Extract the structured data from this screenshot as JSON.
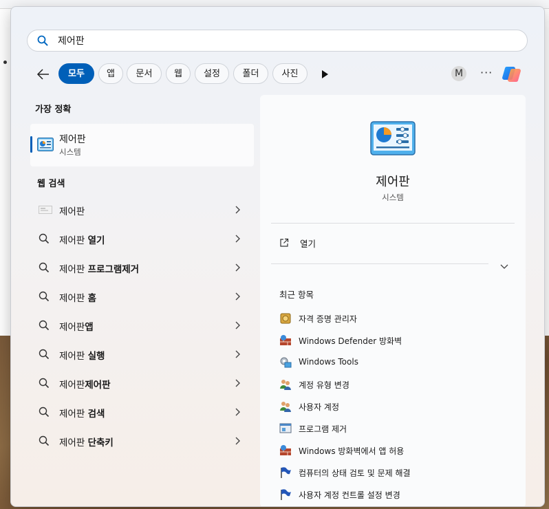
{
  "search": {
    "value": "제어판"
  },
  "filters": {
    "back_label": "뒤로",
    "chips": [
      "모두",
      "앱",
      "문서",
      "웹",
      "설정",
      "폴더",
      "사진"
    ],
    "avatar": "M",
    "more": "···"
  },
  "best_match": {
    "section_title": "가장 정확",
    "title": "제어판",
    "subtitle": "시스템"
  },
  "web_search": {
    "section_title": "웹 검색",
    "items": [
      {
        "prefix": "제어판",
        "suffix": ""
      },
      {
        "prefix": "제어판 ",
        "suffix": "열기"
      },
      {
        "prefix": "제어판 ",
        "suffix": "프로그램제거"
      },
      {
        "prefix": "제어판 ",
        "suffix": "홈"
      },
      {
        "prefix": "제어판",
        "suffix": "앱"
      },
      {
        "prefix": "제어판 ",
        "suffix": "실행"
      },
      {
        "prefix": "제어판",
        "suffix": "제어판"
      },
      {
        "prefix": "제어판 ",
        "suffix": "검색"
      },
      {
        "prefix": "제어판 ",
        "suffix": "단축키"
      }
    ]
  },
  "detail": {
    "name": "제어판",
    "kind": "시스템",
    "open_label": "열기",
    "recent_title": "최근 항목",
    "recent": [
      {
        "label": "자격 증명 관리자",
        "icon": "credential-manager-icon"
      },
      {
        "label": "Windows Defender 방화벽",
        "icon": "firewall-icon"
      },
      {
        "label": "Windows Tools",
        "icon": "windows-tools-icon"
      },
      {
        "label": "계정 유형 변경",
        "icon": "users-icon"
      },
      {
        "label": "사용자 계정",
        "icon": "users-icon"
      },
      {
        "label": "프로그램 제거",
        "icon": "programs-icon"
      },
      {
        "label": "Windows 방화벽에서 앱 허용",
        "icon": "firewall-icon"
      },
      {
        "label": "컴퓨터의 상태 검토 및 문제 해결",
        "icon": "flag-icon"
      },
      {
        "label": "사용자 계정 컨트롤 설정 변경",
        "icon": "flag-icon"
      }
    ]
  },
  "colors": {
    "accent": "#005fb8"
  }
}
